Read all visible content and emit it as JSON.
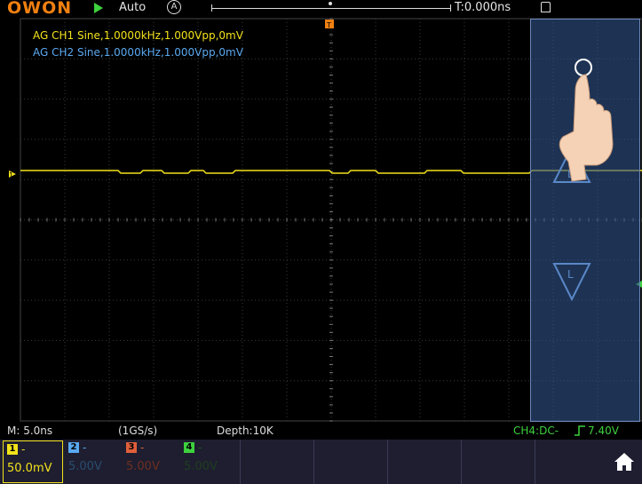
{
  "header": {
    "logo": "OWON",
    "trigger_mode": "Auto",
    "acquire_mode_icon": "A",
    "trigger_delay": "T:0.000ns"
  },
  "waveform_info": {
    "ch1": "AG CH1 Sine,1.0000kHz,1.000Vpp,0mV",
    "ch2": "AG CH2 Sine,1.0000kHz,1.000Vpp,0mV"
  },
  "status_bar": {
    "timebase": "M: 5.0ns",
    "sample_rate": "(1GS/s)",
    "depth": "Depth:10K",
    "trigger": "CH4:DC-",
    "trigger_level": "7.40V"
  },
  "channels": [
    {
      "num": "1",
      "dash": "-",
      "value": "50.0mV",
      "color": "#f2e21a"
    },
    {
      "num": "2",
      "dash": "-",
      "value": "5.00V",
      "color": "#5aa9f0"
    },
    {
      "num": "3",
      "dash": "-",
      "value": "5.00V",
      "color": "#e0603a"
    },
    {
      "num": "4",
      "dash": "-",
      "value": "5.00V",
      "color": "#3dd13d"
    }
  ],
  "colors": {
    "ch1": "#f2e21a",
    "ch2": "#5aa9f0",
    "ch3": "#e0603a",
    "ch4": "#3dd13d",
    "trigger_panel": "#32558c"
  },
  "icons": {
    "home": "home-icon",
    "lock": "lock-icon",
    "run": "play-icon",
    "trigger_up": "trigger-level-up-icon",
    "trigger_down": "trigger-level-down-icon"
  }
}
